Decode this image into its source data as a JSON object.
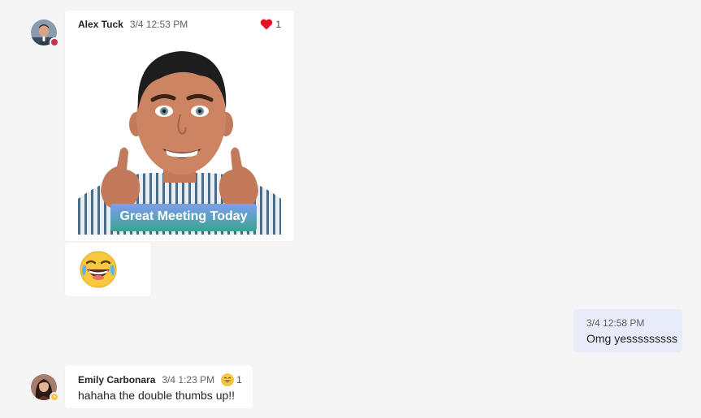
{
  "messages": [
    {
      "author": "Alex Tuck",
      "time": "3/4 12:53 PM",
      "reaction": {
        "icon": "heart-icon",
        "count": "1",
        "color": "#e81123"
      },
      "sticker_caption": "Great Meeting Today",
      "presence_color": "#c4314b"
    },
    {
      "emoji": "laughing-tears-emoji"
    },
    {
      "time": "3/4 12:58 PM",
      "text": "Omg yesssssssss"
    },
    {
      "author": "Emily Carbonara",
      "time": "3/4 1:23 PM",
      "reaction": {
        "icon": "grinning-face-icon",
        "count": "1"
      },
      "text": "hahaha the double thumbs up!!",
      "presence_color": "#f8c24a"
    }
  ],
  "colors": {
    "background": "#f5f5f5",
    "bubble": "#ffffff",
    "outgoing_bubble": "#e8ebfa"
  }
}
